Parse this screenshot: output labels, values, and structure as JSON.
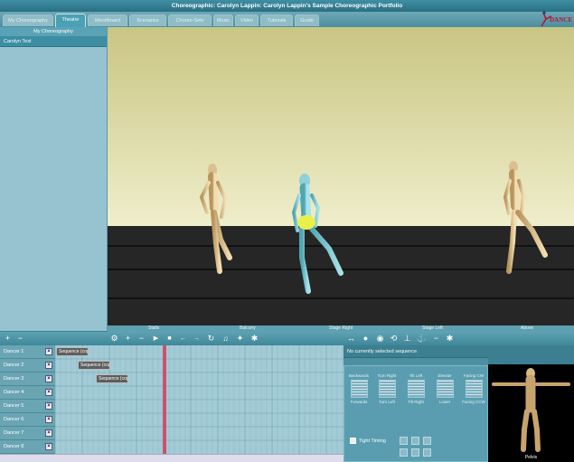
{
  "window": {
    "title": "Choreographic: Carolyn Lappin: Carolyn Lappin's Sample Choreographic Portfolio"
  },
  "logo": {
    "text": "DANCE"
  },
  "tabs": [
    {
      "label": "My Choreography",
      "active": false
    },
    {
      "label": "Theatre",
      "active": true
    },
    {
      "label": "Moodboard",
      "active": false
    },
    {
      "label": "Scenarios",
      "active": false
    },
    {
      "label": "Choreo-Sets",
      "active": false
    },
    {
      "label": "Music",
      "active": false
    },
    {
      "label": "Video",
      "active": false
    },
    {
      "label": "Tutorials",
      "active": false
    },
    {
      "label": "Guide",
      "active": false
    }
  ],
  "left_panel": {
    "header": "My Choreography",
    "items": [
      "Carolyn Test"
    ]
  },
  "camera_views": [
    "Stalls",
    "Balcony",
    "Stage Right",
    "Stage Left",
    "Above"
  ],
  "dancers": [
    "Dancer 1",
    "Dancer 2",
    "Dancer 3",
    "Dancer 4",
    "Dancer 5",
    "Dancer 6",
    "Dancer 7",
    "Dancer 8"
  ],
  "sequences": [
    {
      "label": "Sequence (cop",
      "row": 0
    },
    {
      "label": "Sequence (cop",
      "row": 1
    },
    {
      "label": "Sequence (cop",
      "row": 2
    }
  ],
  "sequence_panel": {
    "message": "No currently selected sequence",
    "top_labels": [
      "Backwards",
      "Turn Right",
      "Tilt Left",
      "Elevate",
      "Facing CW"
    ],
    "bottom_labels": [
      "Forwards",
      "Turn Left",
      "Tilt Right",
      "Lower",
      "Facing CCW"
    ],
    "tight_timing": "Tight Timing"
  },
  "pose_view": {
    "label": "Pelvis"
  }
}
